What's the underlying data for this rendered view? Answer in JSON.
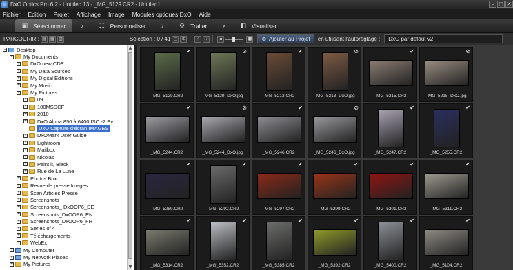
{
  "window": {
    "title": "DxO Optics Pro 6.2 - Untitled 13 - _MG_5129.CR2 - Untitled1",
    "controls": [
      "minimize-icon",
      "maximize-icon",
      "close-icon"
    ]
  },
  "menu": [
    "Fichier",
    "Edition",
    "Projet",
    "Affichage",
    "Image",
    "Modules optiques DxO",
    "Aide"
  ],
  "tabs": [
    {
      "label": "Sélectionner",
      "icon": "select-icon",
      "active": true
    },
    {
      "label": "Personnaliser",
      "icon": "customize-icon",
      "active": false
    },
    {
      "label": "Traiter",
      "icon": "gear-icon",
      "active": false
    },
    {
      "label": "Visualiser",
      "icon": "view-icon",
      "active": false
    }
  ],
  "toolbar": {
    "browse_label": "PARCOURIR :",
    "selection": "Sélection : 0 / 41",
    "add_project": "Ajouter au Projet",
    "preset_label": "en utilisant l'autoréglage :",
    "preset_value": "DxO par défaut v2"
  },
  "tree": [
    {
      "level": 0,
      "label": "Desktop",
      "expander": "−",
      "icon": "desktop"
    },
    {
      "level": 1,
      "label": "My Documents",
      "expander": "−",
      "icon": "folder"
    },
    {
      "level": 2,
      "label": "DxO new CDE",
      "expander": "+",
      "icon": "folder"
    },
    {
      "level": 2,
      "label": "My Data Sources",
      "expander": "+",
      "icon": "folder"
    },
    {
      "level": 2,
      "label": "My Digital Editions",
      "expander": "+",
      "icon": "folder"
    },
    {
      "level": 2,
      "label": "My Music",
      "expander": "+",
      "icon": "folder"
    },
    {
      "level": 2,
      "label": "My Pictures",
      "expander": "−",
      "icon": "folder"
    },
    {
      "level": 3,
      "label": "09",
      "expander": "+",
      "icon": "folder"
    },
    {
      "level": 3,
      "label": "100MSDCF",
      "expander": "+",
      "icon": "folder"
    },
    {
      "level": 3,
      "label": "2010",
      "expander": "+",
      "icon": "folder"
    },
    {
      "level": 3,
      "label": "DxO Alpha 850 à 6400 ISO -2 Ev",
      "expander": "+",
      "icon": "folder"
    },
    {
      "level": 3,
      "label": "DxO Capture d'écran IMAGES",
      "expander": "",
      "icon": "folder",
      "selected": true
    },
    {
      "level": 3,
      "label": "DxOMark User Guide",
      "expander": "+",
      "icon": "folder"
    },
    {
      "level": 3,
      "label": "Lightroom",
      "expander": "+",
      "icon": "folder"
    },
    {
      "level": 3,
      "label": "Mailbox",
      "expander": "+",
      "icon": "folder"
    },
    {
      "level": 3,
      "label": "Nicolas",
      "expander": "+",
      "icon": "folder"
    },
    {
      "level": 3,
      "label": "Paint it, Black",
      "expander": "+",
      "icon": "folder"
    },
    {
      "level": 3,
      "label": "Rue de La Lune",
      "expander": "+",
      "icon": "folder"
    },
    {
      "level": 2,
      "label": "Photos Box",
      "expander": "+",
      "icon": "folder"
    },
    {
      "level": 2,
      "label": "Revue de presse Images",
      "expander": "+",
      "icon": "folder"
    },
    {
      "level": 2,
      "label": "Scan Articles Presse",
      "expander": "+",
      "icon": "folder"
    },
    {
      "level": 2,
      "label": "Screenshots",
      "expander": "+",
      "icon": "folder"
    },
    {
      "level": 2,
      "label": "Screenshots_ DxOOP6_DE",
      "expander": "+",
      "icon": "folder"
    },
    {
      "level": 2,
      "label": "Screenshots_DxOOP6_EN",
      "expander": "+",
      "icon": "folder"
    },
    {
      "level": 2,
      "label": "Screenshots_DxOOP6_FR",
      "expander": "+",
      "icon": "folder"
    },
    {
      "level": 2,
      "label": "Series of 4",
      "expander": "+",
      "icon": "folder"
    },
    {
      "level": 2,
      "label": "Téléchargements",
      "expander": "+",
      "icon": "folder"
    },
    {
      "level": 2,
      "label": "WebEx",
      "expander": "+",
      "icon": "folder"
    },
    {
      "level": 1,
      "label": "My Computer",
      "expander": "+",
      "icon": "drive"
    },
    {
      "level": 1,
      "label": "My Network Places",
      "expander": "+",
      "icon": "drive"
    },
    {
      "level": 1,
      "label": "My Pictures",
      "expander": "+",
      "icon": "folder"
    }
  ],
  "thumbnails": [
    {
      "name": "_MG_5129.CR2",
      "badge": "check",
      "color": "#5b6b4a",
      "orient": "portrait"
    },
    {
      "name": "_MG_5129_DxO.jpg",
      "badge": "none",
      "color": "#6d7856",
      "orient": "portrait"
    },
    {
      "name": "_MG_5213.CR2",
      "badge": "check",
      "color": "#6a4b36",
      "orient": "portrait"
    },
    {
      "name": "_MG_5213_DxO.jpg",
      "badge": "none",
      "color": "#7d5b43",
      "orient": "portrait"
    },
    {
      "name": "_MG_5215.CR2",
      "badge": "check",
      "color": "#8b7c72",
      "orient": "landscape"
    },
    {
      "name": "_MG_5215_DxO.jpg",
      "badge": "none",
      "color": "#9a8d82",
      "orient": "landscape"
    },
    {
      "name": "_MG_5244.CR2",
      "badge": "check",
      "color": "#9a9aa2",
      "orient": "landscape"
    },
    {
      "name": "_MG_5244_DxO.jpg",
      "badge": "none",
      "color": "#a6a6ad",
      "orient": "landscape"
    },
    {
      "name": "_MG_5246.CR2",
      "badge": "check",
      "color": "#8c8b90",
      "orient": "landscape"
    },
    {
      "name": "_MG_5246_DxO.jpg",
      "badge": "none",
      "color": "#98979b",
      "orient": "landscape"
    },
    {
      "name": "_MG_5247.CR2",
      "badge": "check",
      "color": "#a9a3b2",
      "orient": "portrait"
    },
    {
      "name": "_MG_5255.CR2",
      "badge": "check",
      "color": "#2a2f5e",
      "orient": "portrait"
    },
    {
      "name": "_MG_5289.CR2",
      "badge": "check",
      "color": "#2b2640",
      "orient": "landscape"
    },
    {
      "name": "_MG_5292.CR2",
      "badge": "check",
      "color": "#6a6a6a",
      "orient": "portrait"
    },
    {
      "name": "_MG_5297.CR2",
      "badge": "check",
      "color": "#8c2a18",
      "orient": "landscape"
    },
    {
      "name": "_MG_5299.CR2",
      "badge": "check",
      "color": "#9a3518",
      "orient": "landscape"
    },
    {
      "name": "_MG_5301.CR2",
      "badge": "check",
      "color": "#8e1512",
      "orient": "landscape"
    },
    {
      "name": "_MG_5311.CR2",
      "badge": "check",
      "color": "#9d9a8e",
      "orient": "landscape"
    },
    {
      "name": "_MG_5314.CR2",
      "badge": "check",
      "color": "#7a7a6e",
      "orient": "landscape"
    },
    {
      "name": "_MG_5352.CR2",
      "badge": "check",
      "color": "#b9bcc2",
      "orient": "portrait"
    },
    {
      "name": "_MG_5385.CR2",
      "badge": "check",
      "color": "#6b6d6a",
      "orient": "portrait"
    },
    {
      "name": "_MG_5392.CR2",
      "badge": "check",
      "color": "#8f9a2a",
      "orient": "landscape"
    },
    {
      "name": "_MG_5400.CR2",
      "badge": "check",
      "color": "#8a8f95",
      "orient": "portrait"
    },
    {
      "name": "_MG_5104.CR2",
      "badge": "check",
      "color": "#8e8a83",
      "orient": "landscape"
    }
  ]
}
